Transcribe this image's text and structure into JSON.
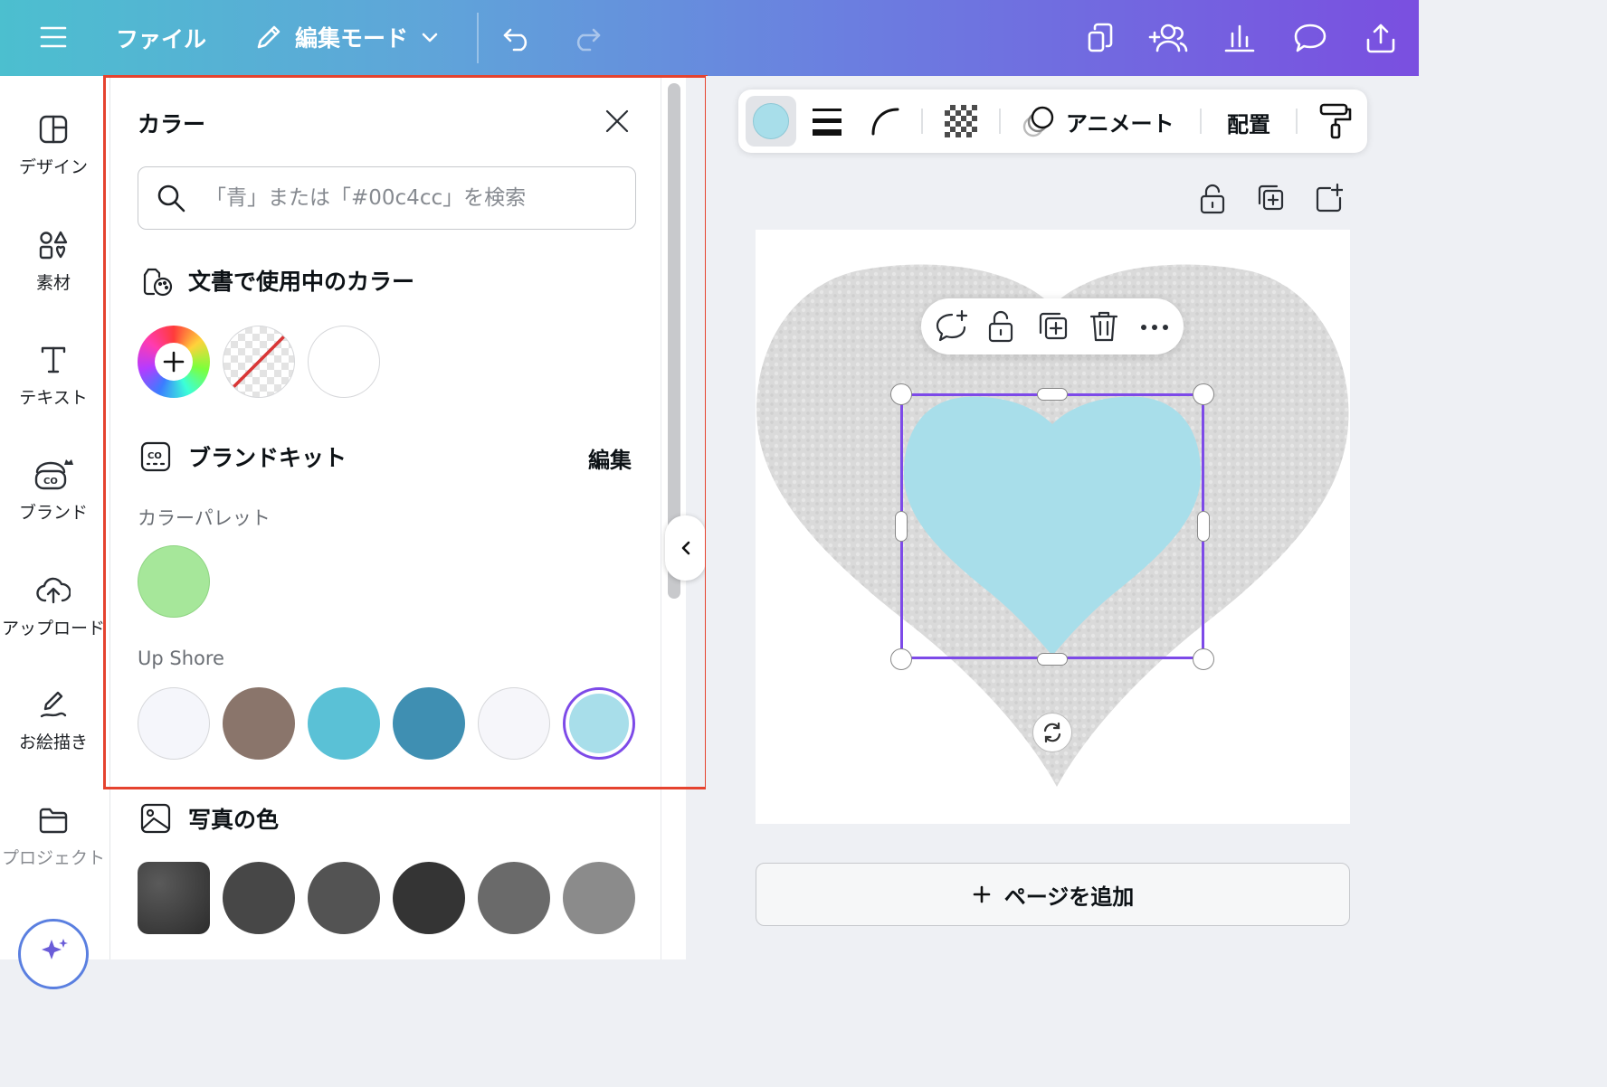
{
  "topbar": {
    "file_label": "ファイル",
    "edit_mode_label": "編集モード"
  },
  "rail": {
    "items": [
      {
        "label": "デザイン",
        "icon": "layout-icon"
      },
      {
        "label": "素材",
        "icon": "shapes-icon"
      },
      {
        "label": "テキスト",
        "icon": "text-icon"
      },
      {
        "label": "ブランド",
        "icon": "brand-icon"
      },
      {
        "label": "アップロード",
        "icon": "cloud-upload-icon"
      },
      {
        "label": "お絵描き",
        "icon": "draw-icon"
      },
      {
        "label": "プロジェクト",
        "icon": "folder-icon"
      }
    ]
  },
  "panel": {
    "title": "カラー",
    "search_placeholder": "「青」または「#00c4cc」を検索",
    "doc_colors_heading": "文書で使用中のカラー",
    "brand_kit_heading": "ブランドキット",
    "brand_edit_label": "編集",
    "palette_label": "カラーパレット",
    "palette_colors": [
      "#a6e79a"
    ],
    "upshore_label": "Up Shore",
    "upshore_colors": [
      "#f5f6fb",
      "#8a756b",
      "#5ac1d6",
      "#3f8fb2",
      "#f6f6fa",
      "#a8deea"
    ],
    "photo_colors_heading": "写真の色",
    "photo_colors": [
      "#3c3c3c",
      "#474747",
      "#535353",
      "#343434",
      "#6a6a6a",
      "#8b8b8b"
    ]
  },
  "toolbar": {
    "selected_color": "#a8deea",
    "animate_label": "アニメート",
    "position_label": "配置"
  },
  "canvas": {
    "add_page_label": "ページを追加"
  },
  "colors": {
    "accent": "#7d4ae8",
    "highlight": "#e5432f",
    "heart_fill": "#a8deea"
  }
}
